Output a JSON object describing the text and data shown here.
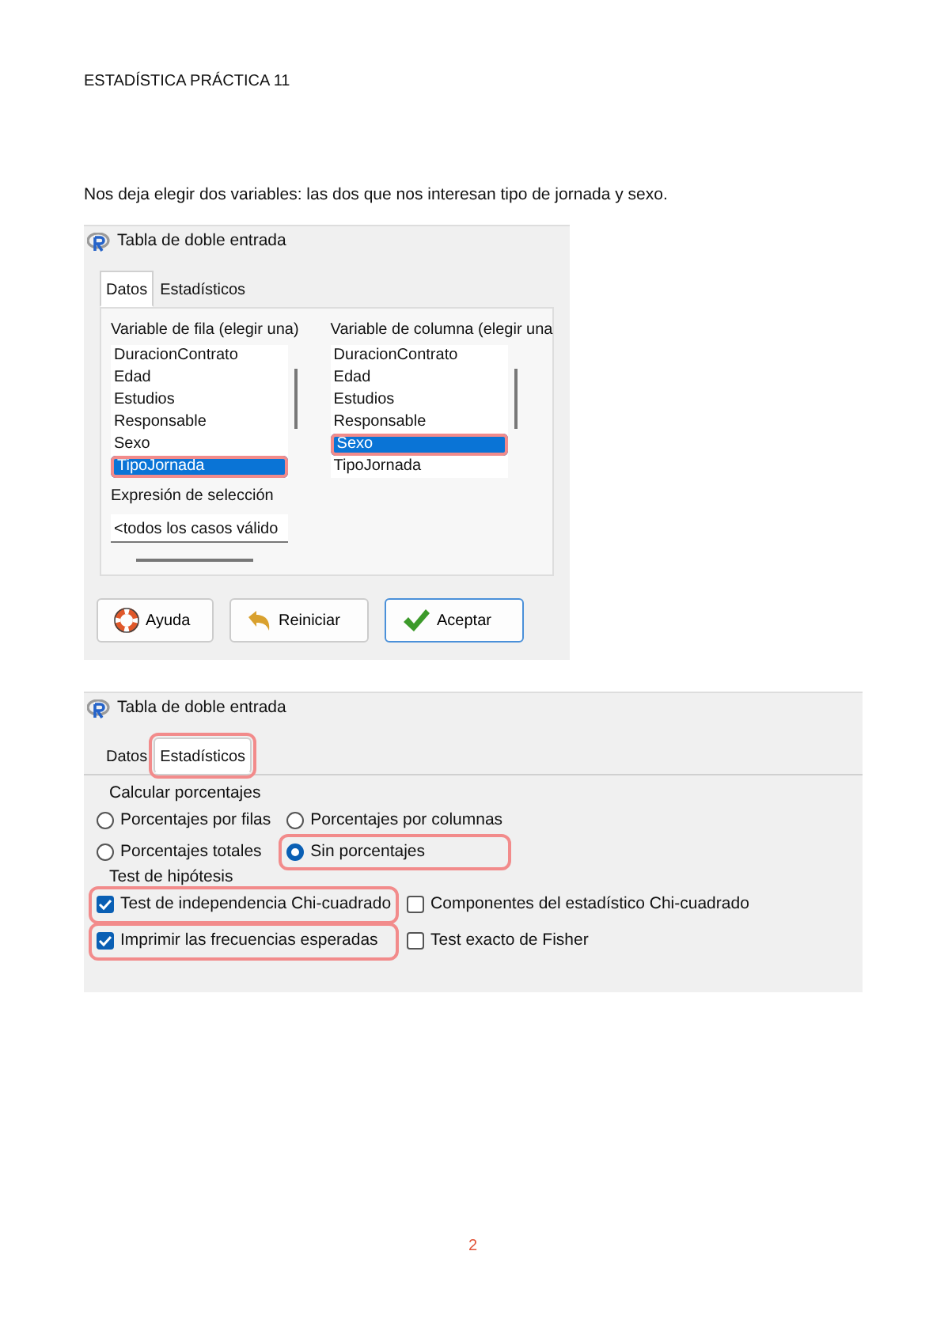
{
  "heading": "ESTADÍSTICA PRÁCTICA 11",
  "intro": "Nos deja elegir dos variables: las dos que nos interesan tipo de jornada y sexo.",
  "dialog_1": {
    "title": "Tabla de doble entrada",
    "tabs": [
      {
        "label": "Datos",
        "selected": true,
        "highlighted": false
      },
      {
        "label": "Estadísticos",
        "selected": false,
        "highlighted": false
      }
    ],
    "lists": [
      {
        "label": "Variable de fila (elegir una)",
        "items": [
          {
            "label": "DuracionContrato",
            "selected": false,
            "highlighted": false
          },
          {
            "label": "Edad",
            "selected": false,
            "highlighted": false
          },
          {
            "label": "Estudios",
            "selected": false,
            "highlighted": false
          },
          {
            "label": "Responsable",
            "selected": false,
            "highlighted": false
          },
          {
            "label": "Sexo",
            "selected": false,
            "highlighted": false
          },
          {
            "label": "TipoJornada",
            "selected": true,
            "highlighted": true
          }
        ]
      },
      {
        "label": "Variable de columna (elegir una",
        "items": [
          {
            "label": "DuracionContrato",
            "selected": false,
            "highlighted": false
          },
          {
            "label": "Edad",
            "selected": false,
            "highlighted": false
          },
          {
            "label": "Estudios",
            "selected": false,
            "highlighted": false
          },
          {
            "label": "Responsable",
            "selected": false,
            "highlighted": false
          },
          {
            "label": "Sexo",
            "selected": true,
            "highlighted": true
          },
          {
            "label": "TipoJornada",
            "selected": false,
            "highlighted": false
          }
        ]
      }
    ],
    "selection_label": "Expresión de selección",
    "selection_value": "<todos los casos válido",
    "buttons": [
      {
        "label": "Ayuda",
        "kind": "help",
        "default": false
      },
      {
        "label": "Reiniciar",
        "kind": "reset",
        "default": false
      },
      {
        "label": "Aceptar",
        "kind": "ok",
        "default": true
      }
    ]
  },
  "dialog_2": {
    "title": "Tabla de doble entrada",
    "tabs": [
      {
        "label": "Datos",
        "selected": false,
        "highlighted": false
      },
      {
        "label": "Estadísticos",
        "selected": true,
        "highlighted": true
      }
    ],
    "percent_group": "Calcular porcentajes",
    "radios": [
      {
        "label": "Porcentajes por filas",
        "selected": false,
        "highlighted": false
      },
      {
        "label": "Porcentajes por columnas",
        "selected": false,
        "highlighted": false
      },
      {
        "label": "Porcentajes totales",
        "selected": false,
        "highlighted": false
      },
      {
        "label": "Sin porcentajes",
        "selected": true,
        "highlighted": true
      }
    ],
    "test_group": "Test de hipótesis",
    "checkboxes": [
      {
        "label": "Test de independencia Chi-cuadrado",
        "checked": true,
        "highlighted": true
      },
      {
        "label": "Componentes del estadístico Chi-cuadrado",
        "checked": false,
        "highlighted": false
      },
      {
        "label": "Imprimir las frecuencias esperadas",
        "checked": true,
        "highlighted": true
      },
      {
        "label": "Test exacto de Fisher",
        "checked": false,
        "highlighted": false
      }
    ]
  },
  "page_number": "2"
}
